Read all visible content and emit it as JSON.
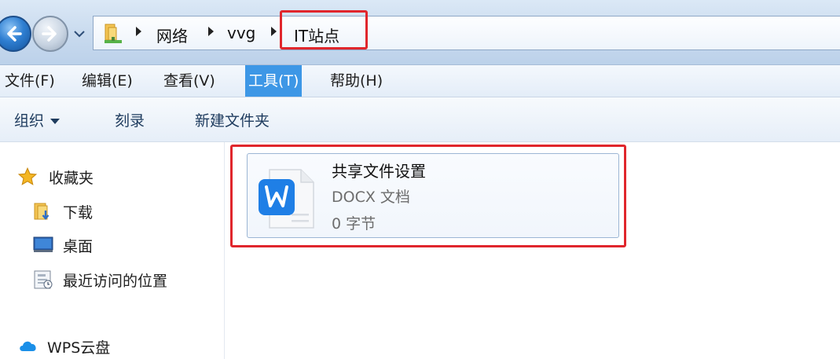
{
  "address_bar": {
    "breadcrumbs": [
      "网络",
      "vvg",
      "IT站点"
    ],
    "location_icon": "folder-network-icon"
  },
  "menu": {
    "items": [
      {
        "label": "文件(F)",
        "active": false
      },
      {
        "label": "编辑(E)",
        "active": false
      },
      {
        "label": "查看(V)",
        "active": false
      },
      {
        "label": "工具(T)",
        "active": true
      },
      {
        "label": "帮助(H)",
        "active": false
      }
    ]
  },
  "toolbar": {
    "organize_label": "组织",
    "burn_label": "刻录",
    "new_folder_label": "新建文件夹"
  },
  "nav_pane": {
    "favorites_label": "收藏夹",
    "items": [
      {
        "label": "下载",
        "icon": "download-folder-icon"
      },
      {
        "label": "桌面",
        "icon": "desktop-icon"
      },
      {
        "label": "最近访问的位置",
        "icon": "recent-places-icon"
      }
    ],
    "cloud_label": "WPS云盘"
  },
  "content": {
    "file": {
      "name": "共享文件设置",
      "type": "DOCX 文档",
      "size": "0 字节",
      "icon": "wps-writer-icon"
    }
  },
  "colors": {
    "highlight_box": "#e0262c",
    "active_menu": "#3d97e6",
    "wps_blue": "#1f7fe6"
  }
}
